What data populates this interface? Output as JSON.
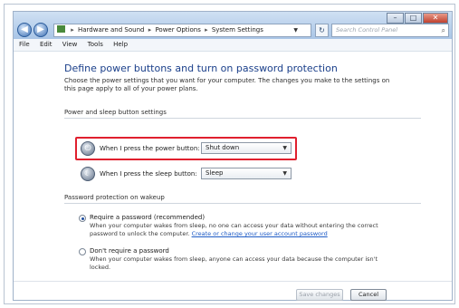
{
  "window": {
    "caption_buttons": [
      "minimize-icon",
      "maximize-icon",
      "close-icon"
    ]
  },
  "nav": {
    "back_icon": "back-arrow-icon",
    "forward_icon": "forward-arrow-icon",
    "breadcrumb": [
      "Hardware and Sound",
      "Power Options",
      "System Settings"
    ],
    "separator": "▸",
    "search_placeholder": "Search Control Panel"
  },
  "menu": [
    "File",
    "Edit",
    "View",
    "Tools",
    "Help"
  ],
  "main": {
    "title": "Define power buttons and turn on password protection",
    "description": "Choose the power settings that you want for your computer. The changes you make to the settings on this page apply to all of your power plans.",
    "power_section_label": "Power and sleep button settings",
    "power_button_label": "When I press the power button:",
    "power_button_value": "Shut down",
    "sleep_button_label": "When I press the sleep button:",
    "sleep_button_value": "Sleep",
    "password_section_label": "Password protection on wakeup",
    "require_password": {
      "title": "Require a password (recommended)",
      "desc": "When your computer wakes from sleep, no one can access your data without entering the correct password to unlock the computer.",
      "link": "Create or change your user account password"
    },
    "no_password": {
      "title": "Don't require a password",
      "desc": "When your computer wakes from sleep, anyone can access your data because the computer isn't locked."
    }
  },
  "footer": {
    "save_label": "Save changes",
    "cancel_label": "Cancel"
  },
  "colors": {
    "highlight": "#e0202e",
    "title_blue": "#1a3f8a",
    "link_blue": "#1e5bc6"
  }
}
